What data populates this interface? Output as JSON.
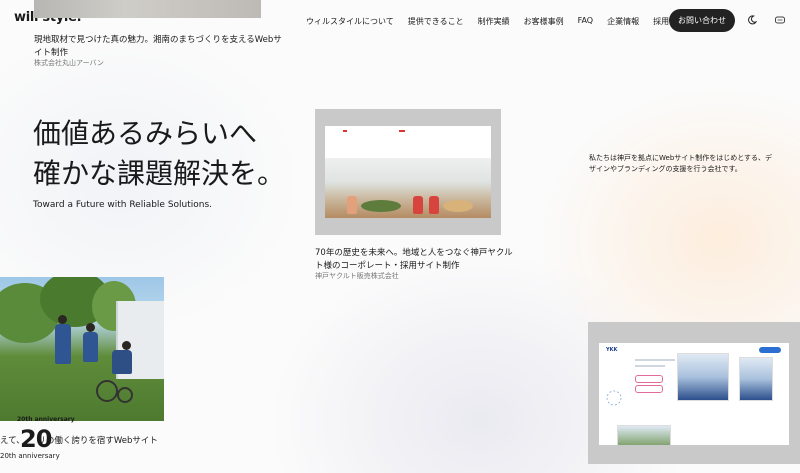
{
  "header": {
    "logo": "will style.",
    "nav": [
      "ウィルスタイルについて",
      "提供できること",
      "制作実績",
      "お客様事例",
      "FAQ",
      "企業情報",
      "採用情報"
    ],
    "contact_label": "お問い合わせ"
  },
  "works": {
    "top": {
      "title": "現地取材で見つけた真の魅力。湘南のまちづくりを支えるWebサイト制作",
      "client": "株式会社丸山アーバン"
    },
    "middle": {
      "title": "70年の歴史を未来へ。地域と人をつなぐ神戸ヤクルト様のコーポレート・採用サイト制作",
      "client": "神戸ヤクルト販売株式会社"
    },
    "bottom_left": {
      "title": "えて、　　リの働く誇りを宿すWebサイト"
    }
  },
  "hero": {
    "line1": "価値あるみらいへ",
    "line2": "確かな課題解決を。",
    "subtitle": "Toward a Future with Reliable Solutions."
  },
  "about": {
    "text": "私たちは神戸を拠点にWebサイト制作をはじめとする、デザインやブランディングの支援を行う会社です。"
  },
  "anniversary": {
    "small": "20th anniversary",
    "number": "20",
    "label": "20th anniversary"
  },
  "right_screen": {
    "logo": "YKK"
  },
  "colors": {
    "accent_dark": "#222222",
    "background": "#fbfbfb",
    "card_gray": "#c9c9c9"
  }
}
